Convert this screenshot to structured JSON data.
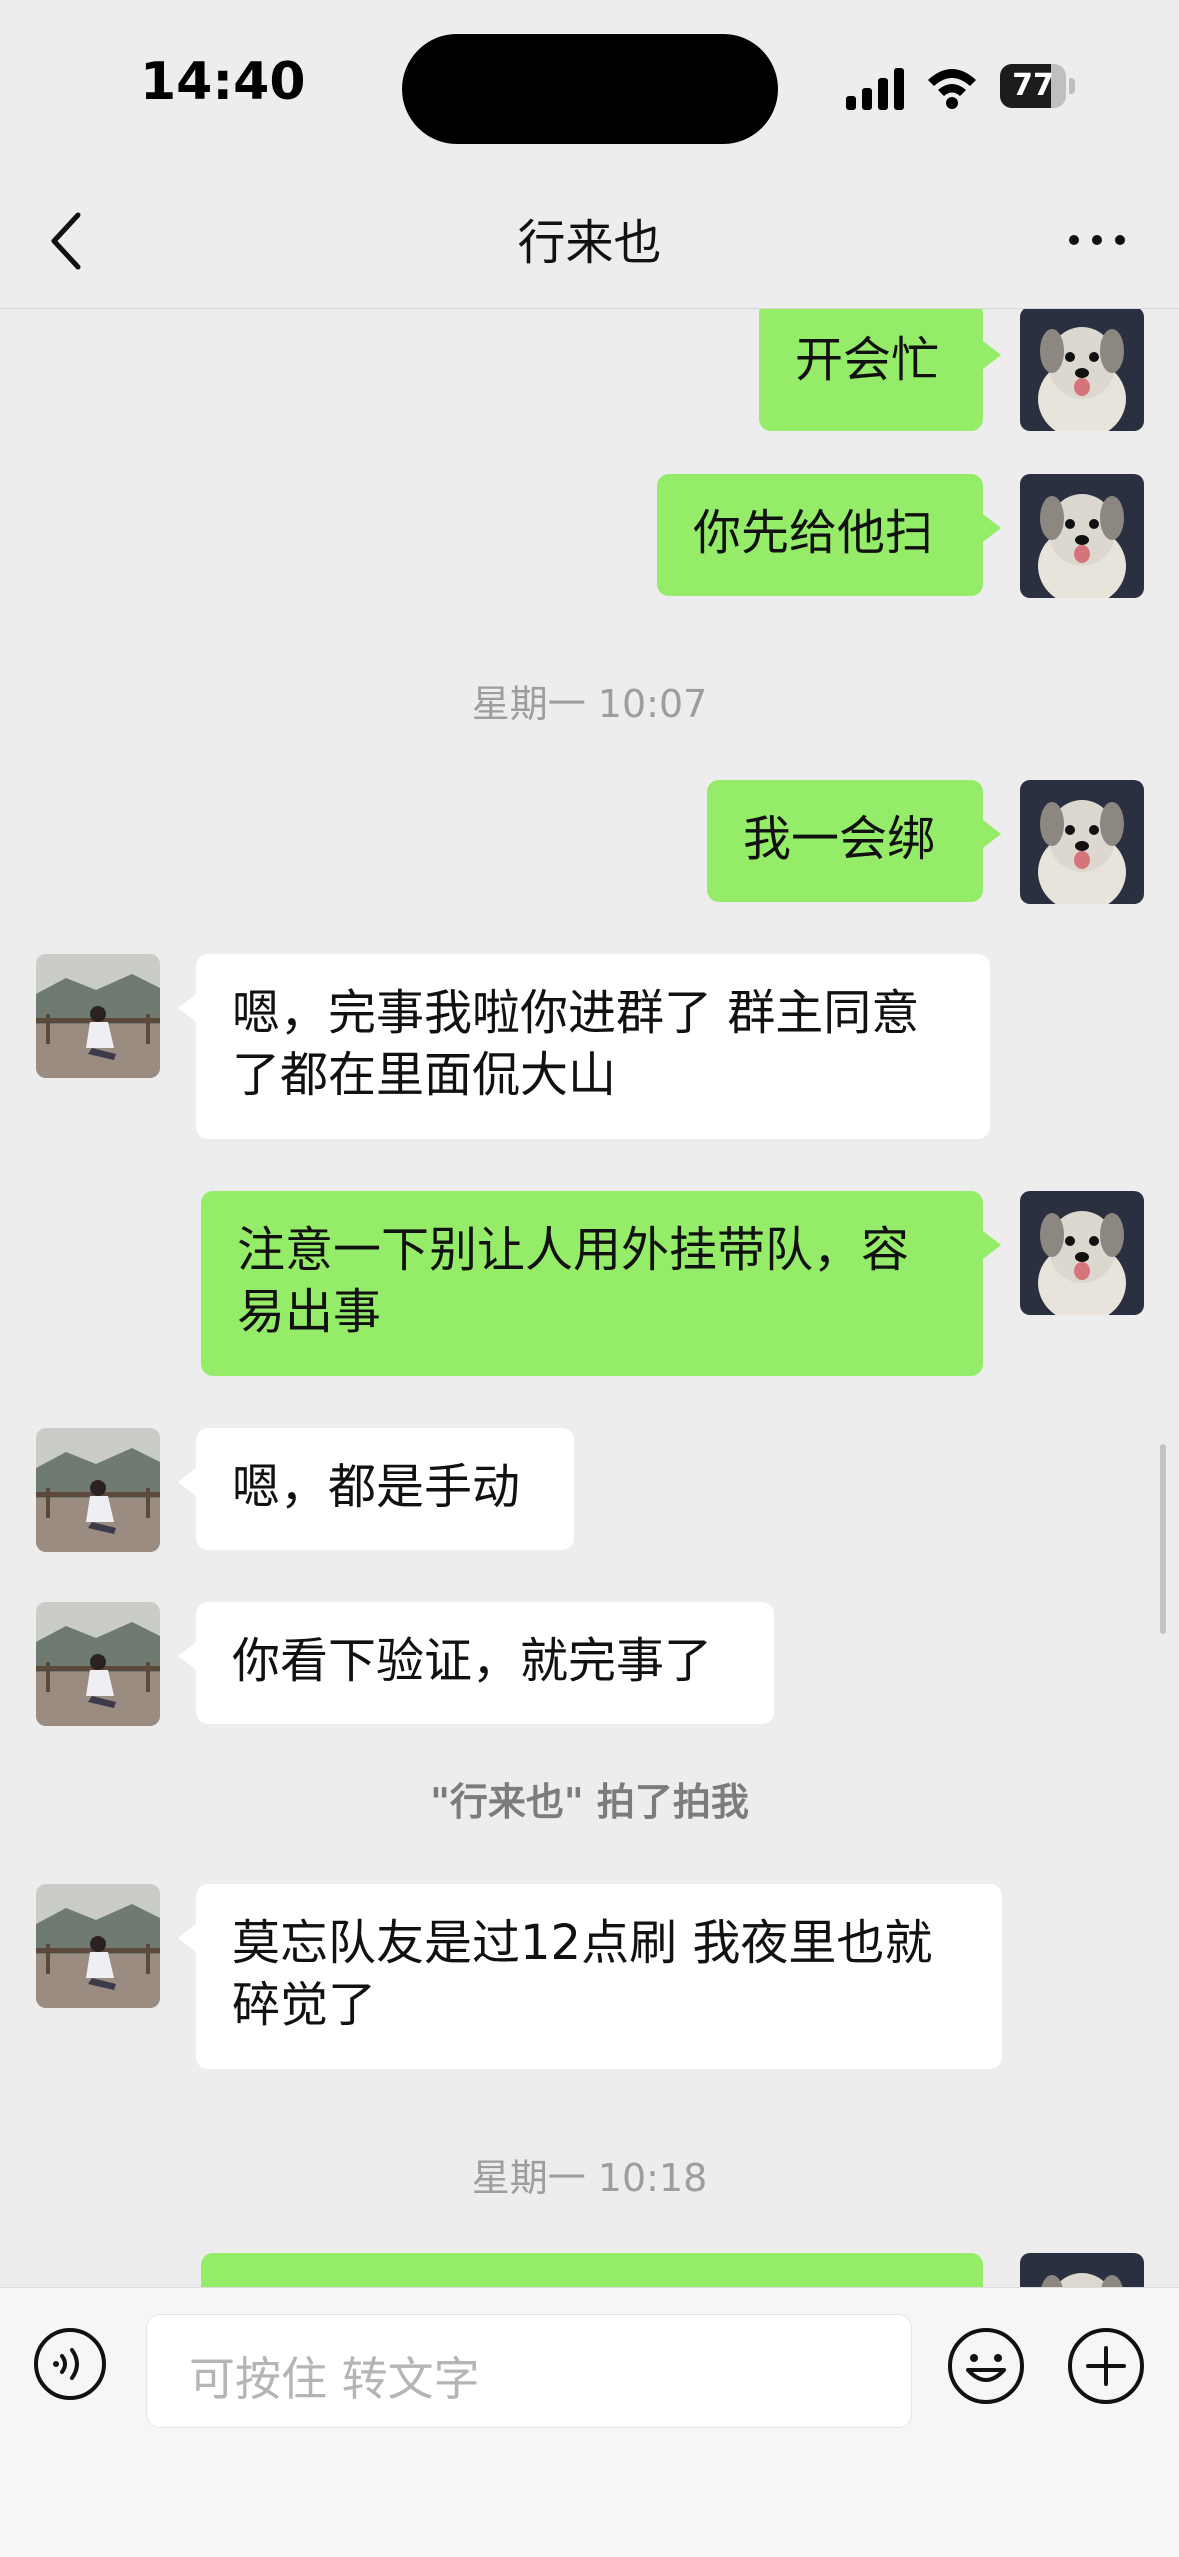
{
  "status_bar": {
    "time": "14:40",
    "battery_percent": "77",
    "battery_level": 0.77
  },
  "nav": {
    "title": "行来也",
    "back_icon": "chevron-left-icon",
    "more_icon": "more-dots-icon"
  },
  "messages": [
    {
      "side": "right",
      "text": "开会忙"
    },
    {
      "side": "right",
      "text": "你先给他扫"
    },
    {
      "type": "time",
      "text": "星期一 10:07"
    },
    {
      "side": "right",
      "text": "我一会绑"
    },
    {
      "side": "left",
      "text": "嗯，完事我啦你进群了 群主同意了都在里面侃大山"
    },
    {
      "side": "right",
      "text": "注意一下别让人用外挂带队，容易出事"
    },
    {
      "side": "left",
      "text": "嗯，都是手动"
    },
    {
      "side": "left",
      "text": "你看下验证，就完事了"
    },
    {
      "type": "system",
      "text": "\"行来也\" 拍了拍我"
    },
    {
      "side": "left",
      "text": "莫忘队友是过12点刷 我夜里也就碎觉了"
    },
    {
      "type": "time",
      "text": "星期一 10:18"
    },
    {
      "side": "right",
      "text": ""
    }
  ],
  "input_bar": {
    "placeholder": "可按住 转文字",
    "voice_icon": "voice-icon",
    "emoji_icon": "emoji-icon",
    "plus_icon": "plus-icon"
  },
  "colors": {
    "background": "#ededed",
    "sent_bubble": "#95ec69",
    "received_bubble": "#ffffff",
    "timestamp_text": "#9d9d9d"
  }
}
